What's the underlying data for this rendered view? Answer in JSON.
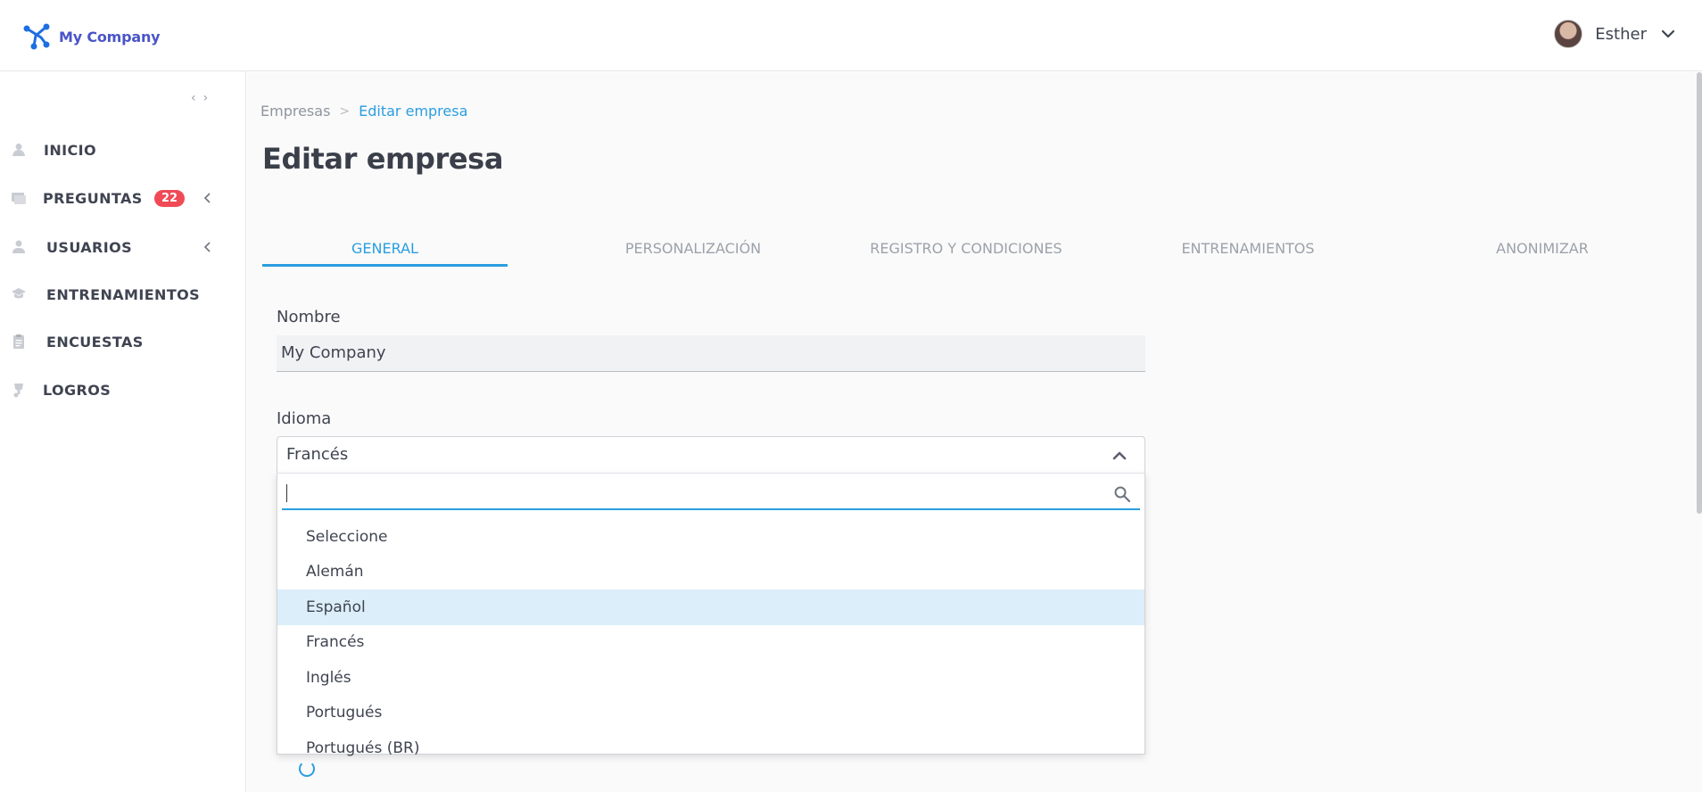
{
  "header": {
    "company_name": "My Company",
    "user_name": "Esther"
  },
  "sidebar": {
    "items": [
      {
        "label": "INICIO",
        "icon": "home-icon"
      },
      {
        "label": "PREGUNTAS",
        "icon": "chat-icon",
        "badge": "22",
        "expandable": true
      },
      {
        "label": "USUARIOS",
        "icon": "user-icon",
        "expandable": true
      },
      {
        "label": "ENTRENAMIENTOS",
        "icon": "graduation-cap-icon"
      },
      {
        "label": "ENCUESTAS",
        "icon": "clipboard-icon"
      },
      {
        "label": "LOGROS",
        "icon": "trophy-icon"
      }
    ]
  },
  "breadcrumb": {
    "parent": "Empresas",
    "current": "Editar empresa"
  },
  "page_title": "Editar empresa",
  "tabs": [
    {
      "label": "GENERAL",
      "active": true
    },
    {
      "label": "PERSONALIZACIÓN",
      "active": false
    },
    {
      "label": "REGISTRO Y CONDICIONES",
      "active": false
    },
    {
      "label": "ENTRENAMIENTOS",
      "active": false
    },
    {
      "label": "ANONIMIZAR",
      "active": false
    }
  ],
  "form": {
    "name_label": "Nombre",
    "name_value": "My Company",
    "language_label": "Idioma",
    "language_value": "Francés",
    "search_value": "",
    "options": [
      "Seleccione",
      "Alemán",
      "Español",
      "Francés",
      "Inglés",
      "Portugués",
      "Portugués (BR)"
    ],
    "highlighted_option": "Español"
  },
  "colors": {
    "accent": "#2a9ee0",
    "brand": "#4a55c8",
    "badge": "#ef4a55",
    "highlight": "#dbeef9"
  }
}
